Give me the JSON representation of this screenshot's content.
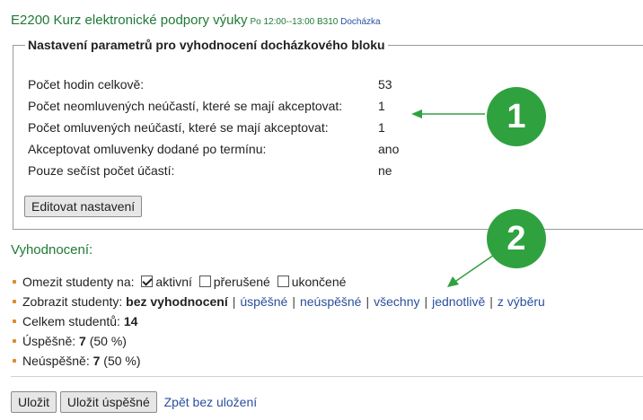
{
  "header": {
    "course_title": "E2200 Kurz elektronické podpory výuky",
    "course_time": "Po 12:00--13:00 B310",
    "attendance_link": "Docházka"
  },
  "settings": {
    "legend": "Nastavení parametrů pro vyhodnocení docházkového bloku",
    "rows": [
      {
        "label": "Počet hodin celkově:",
        "value": "53"
      },
      {
        "label": "Počet neomluvených neúčastí, které se mají akceptovat:",
        "value": "1"
      },
      {
        "label": "Počet omluvených neúčastí, které se mají akceptovat:",
        "value": "1"
      },
      {
        "label": "Akceptovat omluvenky dodané po termínu:",
        "value": "ano"
      },
      {
        "label": "Pouze sečíst počet účastí:",
        "value": "ne"
      }
    ],
    "edit_button": "Editovat nastavení"
  },
  "badges": [
    "1",
    "2"
  ],
  "evaluation": {
    "title": "Vyhodnocení:",
    "filter": {
      "label": "Omezit studenty na:",
      "options": [
        {
          "label": "aktivní",
          "checked": true
        },
        {
          "label": "přerušené",
          "checked": false
        },
        {
          "label": "ukončené",
          "checked": false
        }
      ]
    },
    "show": {
      "label": "Zobrazit studenty:",
      "current": "bez vyhodnocení",
      "links": [
        "úspěšné",
        "neúspěšné",
        "všechny",
        "jednotlivě",
        "z výběru"
      ]
    },
    "total": {
      "label": "Celkem studentů:",
      "value": "14"
    },
    "passed": {
      "label": "Úspěšně:",
      "value": "7",
      "percent": "(50 %)"
    },
    "failed": {
      "label": "Neúspěšně:",
      "value": "7",
      "percent": "(50 %)"
    }
  },
  "footer": {
    "save": "Uložit",
    "save_passed": "Uložit úspěšné",
    "back_link": "Zpět bez uložení"
  },
  "colors": {
    "badge": "#2fa23f",
    "heading_green": "#1e7a38",
    "link_blue": "#2a4f9e",
    "bullet": "#e08a2c"
  }
}
